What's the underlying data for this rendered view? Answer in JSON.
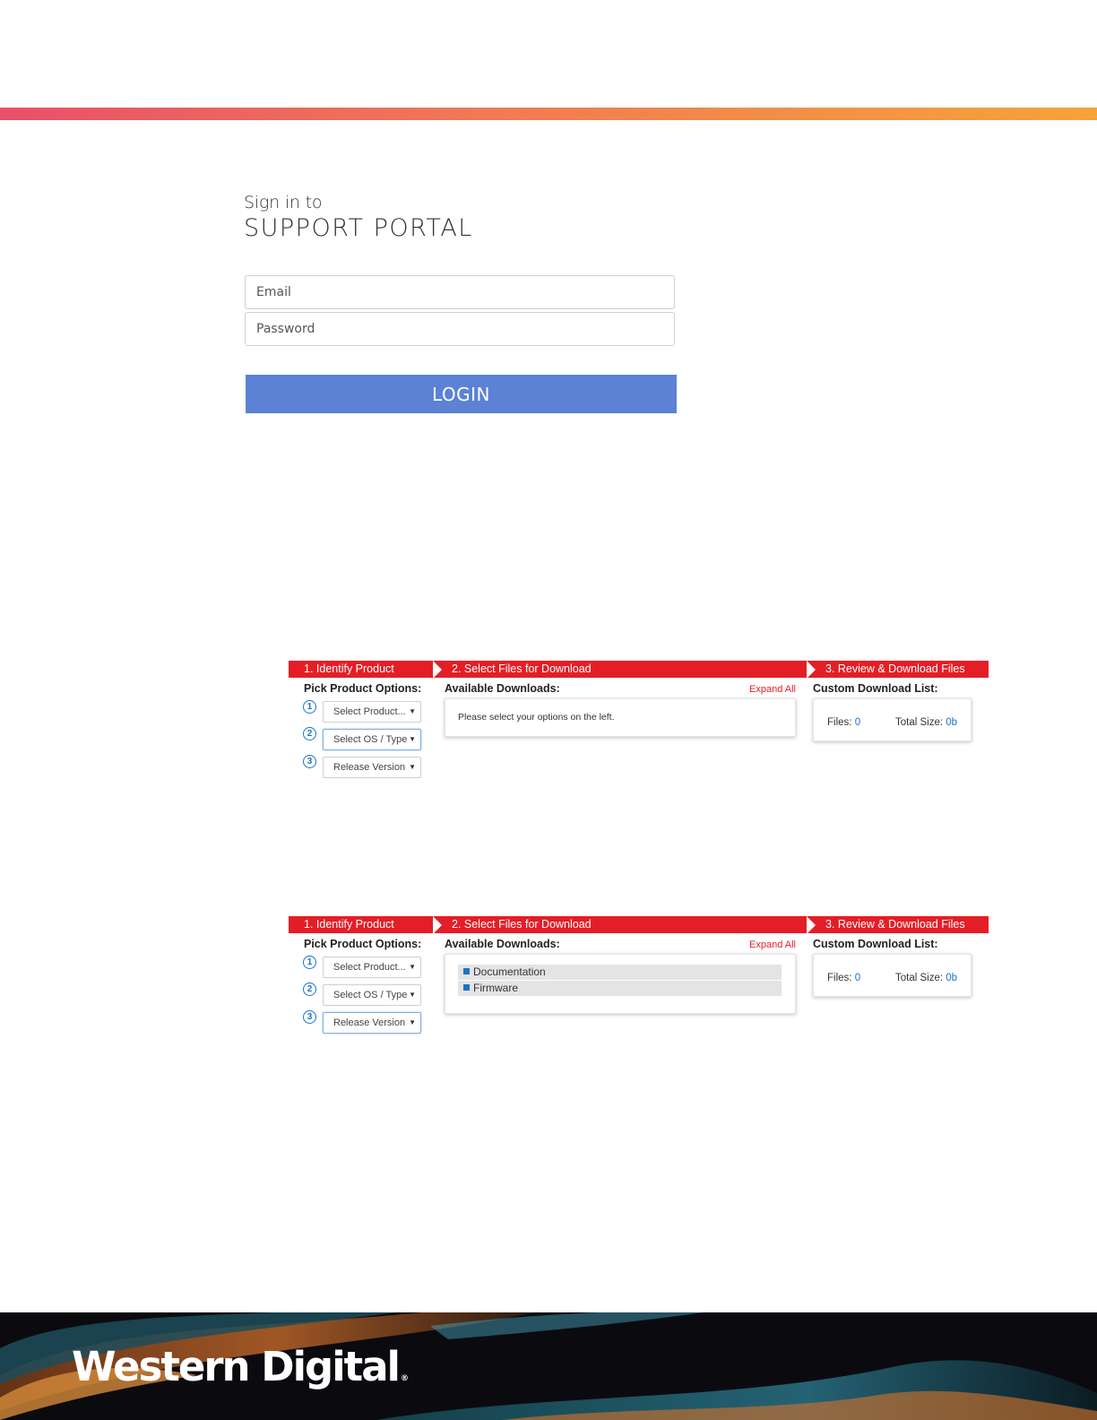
{
  "signin": {
    "line1": "Sign in to",
    "line2": "SUPPORT PORTAL"
  },
  "form": {
    "email_placeholder": "Email",
    "password_placeholder": "Password",
    "login_label": "LOGIN"
  },
  "panel_before": {
    "steps": [
      "1. Identify Product",
      "2. Select Files for Download",
      "3. Review & Download Files"
    ],
    "pick_heading": "Pick Product Options:",
    "available_heading": "Available Downloads:",
    "expand_all": "Expand All",
    "custom_heading": "Custom Download List:",
    "numbers": [
      "1",
      "2",
      "3"
    ],
    "selects": [
      "Select Product...",
      "Select OS / Type",
      "Release Version"
    ],
    "message": "Please select your options on the left.",
    "files_label": "Files:",
    "files_value": "0",
    "size_label": "Total Size:",
    "size_value": "0b"
  },
  "panel_after": {
    "steps": [
      "1. Identify Product",
      "2. Select Files for Download",
      "3. Review & Download Files"
    ],
    "pick_heading": "Pick Product Options:",
    "available_heading": "Available Downloads:",
    "expand_all": "Expand All",
    "custom_heading": "Custom Download List:",
    "numbers": [
      "1",
      "2",
      "3"
    ],
    "selects": [
      "Select Product...",
      "Select OS / Type",
      "Release Version"
    ],
    "downloads": [
      "Documentation",
      "Firmware"
    ],
    "files_label": "Files:",
    "files_value": "0",
    "size_label": "Total Size:",
    "size_value": "0b"
  },
  "footer": {
    "brand": "Western Digital",
    "reg": "®"
  },
  "colors": {
    "accent_red": "#e41e26",
    "login_blue": "#5b82d4",
    "link_blue": "#1a73c8"
  },
  "icons": [
    "chevron-right-icon",
    "caret-down-icon",
    "plus-box-icon"
  ]
}
